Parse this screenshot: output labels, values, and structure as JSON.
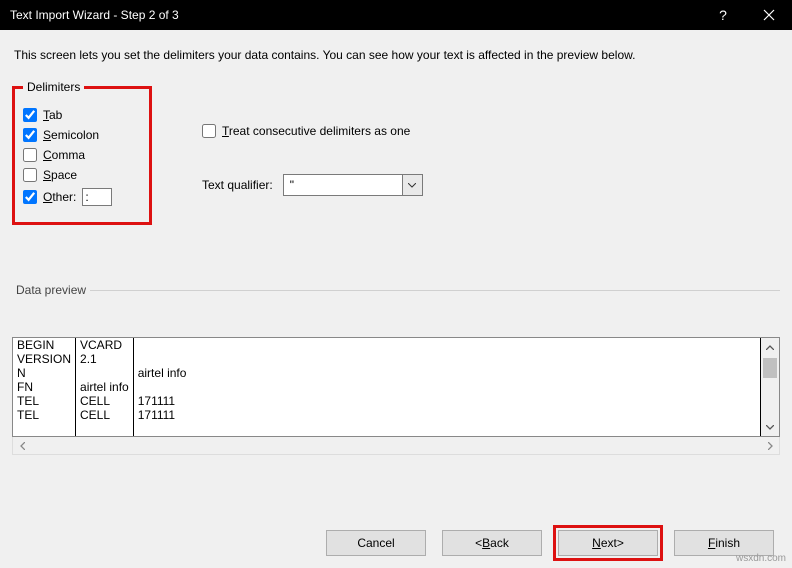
{
  "title": "Text Import Wizard - Step 2 of 3",
  "intro": "This screen lets you set the delimiters your data contains.  You can see how your text is affected in the preview below.",
  "delimiters": {
    "legend": "Delimiters",
    "tab": "ab",
    "semicolon": "emicolon",
    "comma": "omma",
    "space": "pace",
    "other": "ther:",
    "other_value": ":"
  },
  "options": {
    "treat": "reat consecutive delimiters as one",
    "qualifier_label": "Text qualifier:",
    "qualifier_value": "\""
  },
  "preview": {
    "legend": "Data preview",
    "col1": "BEGIN\nVERSION\nN\nFN\nTEL\nTEL",
    "col2": "VCARD\n2.1\n\nairtel info\nCELL\nCELL",
    "col3": "\n\nairtel info\n\n171111\n171111"
  },
  "buttons": {
    "cancel": "Cancel",
    "back_prefix": "< ",
    "back": "ack",
    "next": "ext",
    "next_suffix": " >",
    "finish": "inish"
  },
  "watermark": "wsxdn.com"
}
